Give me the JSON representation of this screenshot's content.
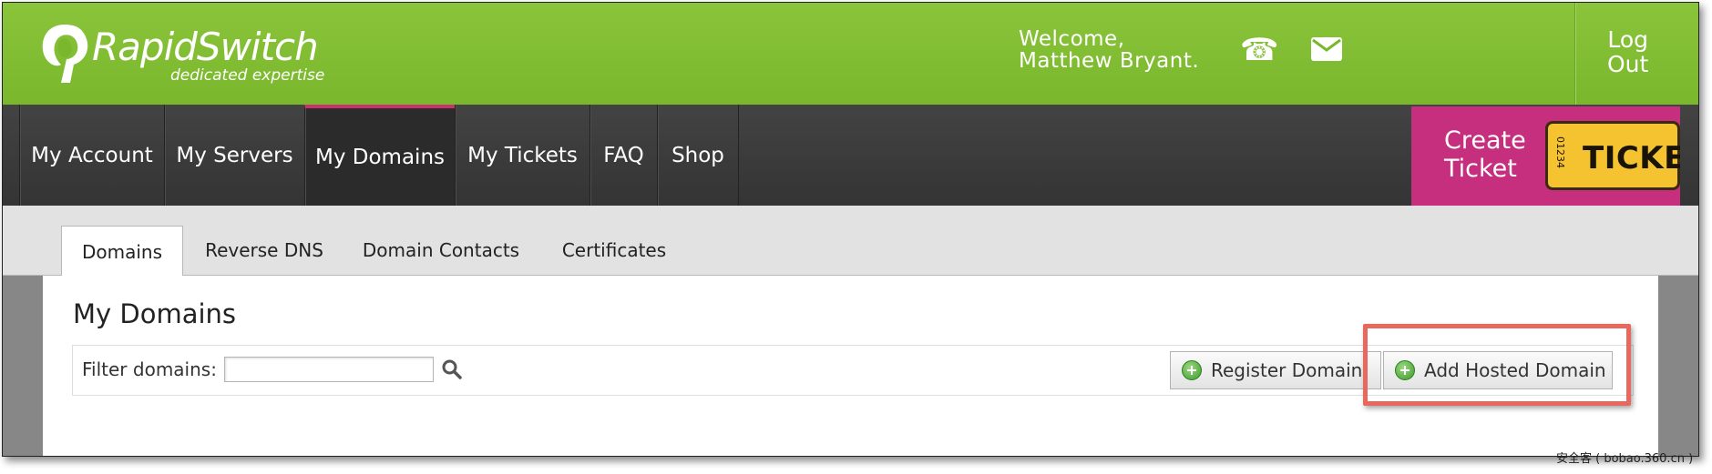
{
  "brand": {
    "name": "RapidSwitch",
    "tagline": "dedicated expertise"
  },
  "header": {
    "welcome_line1": "Welcome,",
    "welcome_line2": "Matthew Bryant.",
    "phone_icon": "☎",
    "logout_line1": "Log",
    "logout_line2": "Out"
  },
  "nav": {
    "items": [
      {
        "label": "My Account"
      },
      {
        "label": "My Servers"
      },
      {
        "label": "My Domains"
      },
      {
        "label": "My Tickets"
      },
      {
        "label": "FAQ"
      },
      {
        "label": "Shop"
      }
    ],
    "active": "My Domains",
    "create_ticket_line1": "Create",
    "create_ticket_line2": "Ticket",
    "ticket_word": "TICKET",
    "ticket_number": "01234"
  },
  "tabs": [
    {
      "label": "Domains"
    },
    {
      "label": "Reverse DNS"
    },
    {
      "label": "Domain Contacts"
    },
    {
      "label": "Certificates"
    }
  ],
  "active_tab": "Domains",
  "main": {
    "title": "My Domains",
    "filter_label": "Filter domains:",
    "filter_value": "",
    "register_button": "Register Domain",
    "add_hosted_button": "Add Hosted Domain"
  },
  "watermark": "安全客 ( bobao.360.cn )",
  "colors": {
    "header_green": "#7ab72d",
    "nav_dark": "#3a3a3a",
    "ticket_pink": "#c52f7d",
    "highlight": "#e8685e"
  }
}
